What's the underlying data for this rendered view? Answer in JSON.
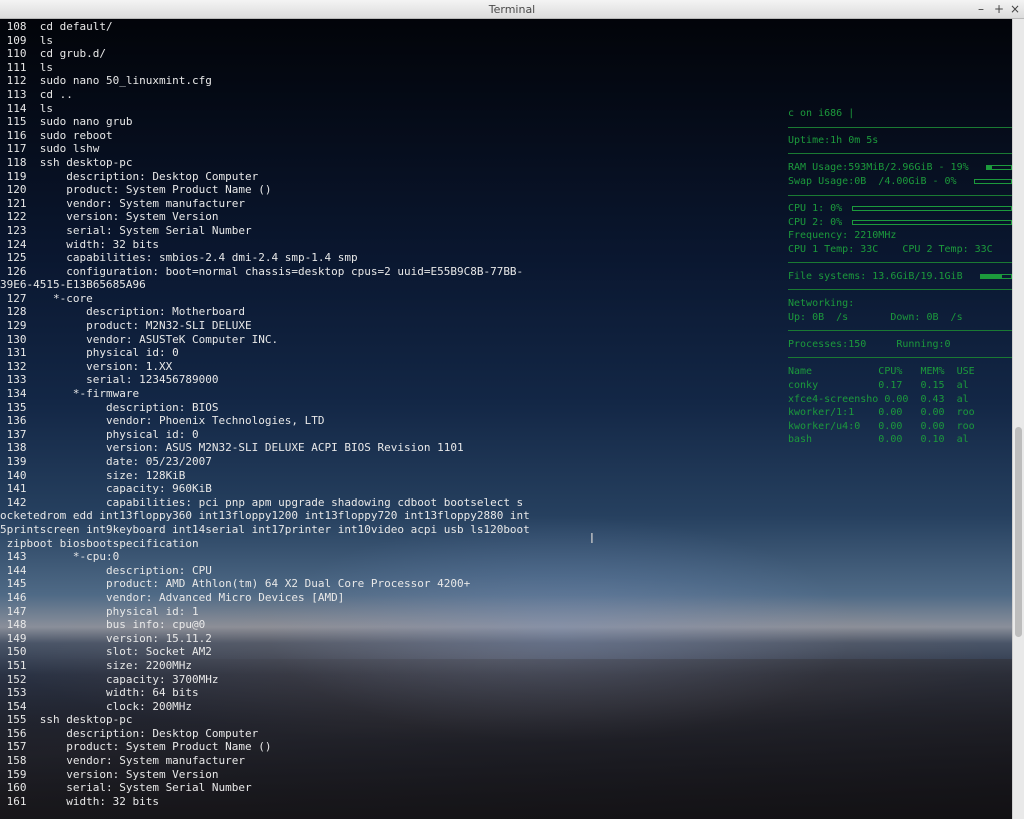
{
  "window": {
    "title": "Terminal",
    "buttons": {
      "minimize": "–",
      "maximize": "+",
      "close": "×"
    }
  },
  "terminal": {
    "lines": [
      " 108  cd default/",
      " 109  ls",
      " 110  cd grub.d/",
      " 111  ls",
      " 112  sudo nano 50_linuxmint.cfg",
      " 113  cd ..",
      " 114  ls",
      " 115  sudo nano grub",
      " 116  sudo reboot",
      " 117  sudo lshw",
      " 118  ssh desktop-pc",
      " 119      description: Desktop Computer",
      " 120      product: System Product Name ()",
      " 121      vendor: System manufacturer",
      " 122      version: System Version",
      " 123      serial: System Serial Number",
      " 124      width: 32 bits",
      " 125      capabilities: smbios-2.4 dmi-2.4 smp-1.4 smp",
      " 126      configuration: boot=normal chassis=desktop cpus=2 uuid=E55B9C8B-77BB-",
      "39E6-4515-E13B65685A96",
      " 127    *-core",
      " 128         description: Motherboard",
      " 129         product: M2N32-SLI DELUXE",
      " 130         vendor: ASUSTeK Computer INC.",
      " 131         physical id: 0",
      " 132         version: 1.XX",
      " 133         serial: 123456789000",
      " 134       *-firmware",
      " 135            description: BIOS",
      " 136            vendor: Phoenix Technologies, LTD",
      " 137            physical id: 0",
      " 138            version: ASUS M2N32-SLI DELUXE ACPI BIOS Revision 1101",
      " 139            date: 05/23/2007",
      " 140            size: 128KiB",
      " 141            capacity: 960KiB",
      " 142            capabilities: pci pnp apm upgrade shadowing cdboot bootselect s",
      "ocketedrom edd int13floppy360 int13floppy1200 int13floppy720 int13floppy2880 int",
      "5printscreen int9keyboard int14serial int17printer int10video acpi usb ls120boot",
      " zipboot biosbootspecification",
      " 143       *-cpu:0",
      " 144            description: CPU",
      " 145            product: AMD Athlon(tm) 64 X2 Dual Core Processor 4200+",
      " 146            vendor: Advanced Micro Devices [AMD]",
      " 147            physical id: 1",
      " 148            bus info: cpu@0",
      " 149            version: 15.11.2",
      " 150            slot: Socket AM2",
      " 151            size: 2200MHz",
      " 152            capacity: 3700MHz",
      " 153            width: 64 bits",
      " 154            clock: 200MHz",
      " 155  ssh desktop-pc",
      " 156      description: Desktop Computer",
      " 157      product: System Product Name ()",
      " 158      vendor: System manufacturer",
      " 159      version: System Version",
      " 160      serial: System Serial Number",
      " 161      width: 32 bits"
    ]
  },
  "conky": {
    "host_line": "c on i686 |",
    "uptime": "Uptime:1h 0m 5s",
    "ram": "RAM Usage:593MiB/2.96GiB - 19%",
    "ram_percent": 19,
    "swap": "Swap Usage:0B  /4.00GiB - 0%",
    "swap_percent": 0,
    "cpu1": "CPU 1: 0%",
    "cpu1_percent": 0,
    "cpu2": "CPU 2: 0%",
    "cpu2_percent": 0,
    "frequency": "Frequency: 2210MHz",
    "temps": "CPU 1 Temp: 33C    CPU 2 Temp: 33C",
    "filesystems": "File systems: 13.6GiB/19.1GiB",
    "fs_percent": 71,
    "networking_label": "Networking:",
    "net_rates": "Up: 0B  /s       Down: 0B  /s",
    "processes": "Processes:150     Running:0",
    "proc_header": "Name           CPU%   MEM%  USE",
    "procs": [
      "conky          0.17   0.15  al",
      "xfce4-screensho 0.00  0.43  al",
      "kworker/1:1    0.00   0.00  roo",
      "kworker/u4:0   0.00   0.00  roo",
      "bash           0.00   0.10  al"
    ],
    "color": "#1c9a3c"
  }
}
